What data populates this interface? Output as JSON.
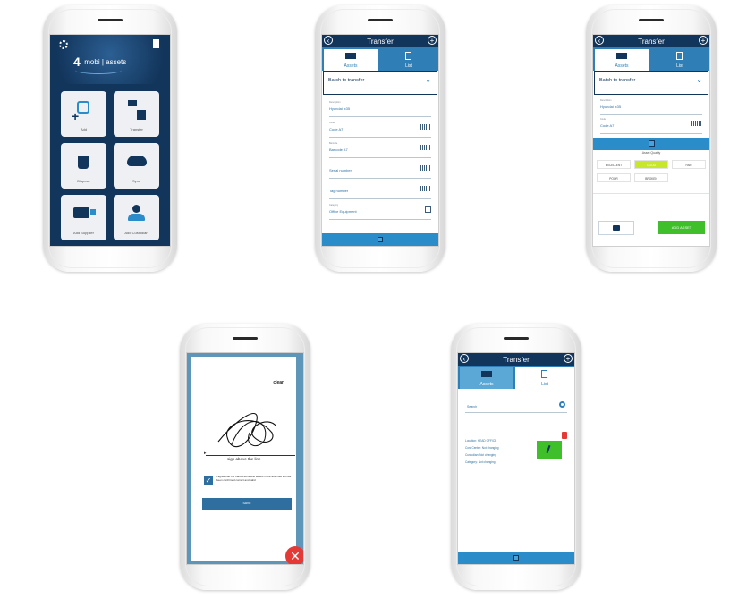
{
  "home": {
    "logo_prefix": "4",
    "logo_text": "mobi | assets",
    "tiles": [
      {
        "label": "Add",
        "icon": "add-asset-icon"
      },
      {
        "label": "Transfer",
        "icon": "transfer-icon"
      },
      {
        "label": "Dispose",
        "icon": "trash-icon"
      },
      {
        "label": "Sync",
        "icon": "cloud-sync-icon"
      },
      {
        "label": "Add Supplier",
        "icon": "forklift-icon"
      },
      {
        "label": "Add Custodian",
        "icon": "person-icon"
      }
    ]
  },
  "transfer_form": {
    "title": "Transfer",
    "tab_assets": "Assets",
    "tab_list": "List",
    "batch": "Batch to transfer",
    "fields": [
      {
        "caption": "Description",
        "value": "Hyundai ix35"
      },
      {
        "caption": "Code",
        "value": "Code A7"
      },
      {
        "caption": "Barcode",
        "value": "Barcode A7"
      },
      {
        "caption": "",
        "value": "Serial number"
      },
      {
        "caption": "",
        "value": "Tag number"
      },
      {
        "caption": "Category",
        "value": "Office Equipment"
      }
    ]
  },
  "quality": {
    "title": "Transfer",
    "tab_assets": "Assets",
    "tab_list": "List",
    "batch": "Batch to transfer",
    "desc_caption": "Description",
    "desc_value": "Hyundai ix35",
    "code_caption": "Code",
    "code_value": "Code A7",
    "heading": "Asset Quality",
    "options": [
      "EXCELLENT",
      "GOOD",
      "FAIR",
      "POOR",
      "BROKEN"
    ],
    "selected": "GOOD",
    "add_label": "ADD ASSET",
    "accent": "#c8e62a"
  },
  "signature": {
    "clear": "clear",
    "line_label": "sign above the line",
    "agree": "I agree that the transactions and assets in the attached list has been confirmed correct and valid",
    "save": "SAVE"
  },
  "transfer_list": {
    "title": "Transfer",
    "tab_assets": "Assets",
    "tab_list": "List",
    "search_placeholder": "Search",
    "item": {
      "location": "Location: HEAD OFFICE",
      "cost_center": "Cost Center: Not changing",
      "custodian": "Custodian: Not changing",
      "category": "Category: Not changing"
    }
  },
  "colors": {
    "navy": "#12355b",
    "blue": "#2a8cc8",
    "green": "#3fbf2a",
    "red": "#e53935"
  }
}
